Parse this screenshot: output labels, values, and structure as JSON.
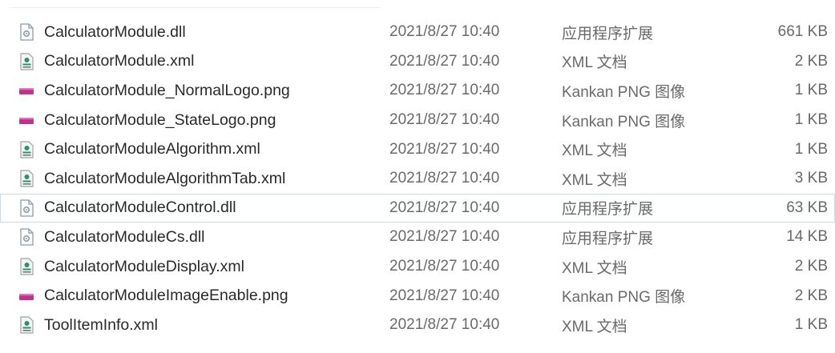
{
  "files": [
    {
      "name": "CalculatorModule.dll",
      "date": "2021/8/27 10:40",
      "type": "应用程序扩展",
      "size": "661 KB",
      "icon": "dll-file-icon"
    },
    {
      "name": "CalculatorModule.xml",
      "date": "2021/8/27 10:40",
      "type": "XML 文档",
      "size": "2 KB",
      "icon": "xml-file-icon"
    },
    {
      "name": "CalculatorModule_NormalLogo.png",
      "date": "2021/8/27 10:40",
      "type": "Kankan PNG 图像",
      "size": "1 KB",
      "icon": "png-file-icon"
    },
    {
      "name": "CalculatorModule_StateLogo.png",
      "date": "2021/8/27 10:40",
      "type": "Kankan PNG 图像",
      "size": "1 KB",
      "icon": "png-file-icon"
    },
    {
      "name": "CalculatorModuleAlgorithm.xml",
      "date": "2021/8/27 10:40",
      "type": "XML 文档",
      "size": "1 KB",
      "icon": "xml-file-icon"
    },
    {
      "name": "CalculatorModuleAlgorithmTab.xml",
      "date": "2021/8/27 10:40",
      "type": "XML 文档",
      "size": "3 KB",
      "icon": "xml-file-icon"
    },
    {
      "name": "CalculatorModuleControl.dll",
      "date": "2021/8/27 10:40",
      "type": "应用程序扩展",
      "size": "63 KB",
      "icon": "dll-file-icon"
    },
    {
      "name": "CalculatorModuleCs.dll",
      "date": "2021/8/27 10:40",
      "type": "应用程序扩展",
      "size": "14 KB",
      "icon": "dll-file-icon"
    },
    {
      "name": "CalculatorModuleDisplay.xml",
      "date": "2021/8/27 10:40",
      "type": "XML 文档",
      "size": "2 KB",
      "icon": "xml-file-icon"
    },
    {
      "name": "CalculatorModuleImageEnable.png",
      "date": "2021/8/27 10:40",
      "type": "Kankan PNG 图像",
      "size": "2 KB",
      "icon": "png-file-icon"
    },
    {
      "name": "ToolItemInfo.xml",
      "date": "2021/8/27 10:40",
      "type": "XML 文档",
      "size": "1 KB",
      "icon": "xml-file-icon"
    }
  ],
  "selected_index": 6,
  "colors": {
    "png_icon": "#c0308f",
    "xml_icon": "#2f8f6a",
    "dll_icon": "#8a9aae",
    "selection_border": "#c9d9ea"
  }
}
